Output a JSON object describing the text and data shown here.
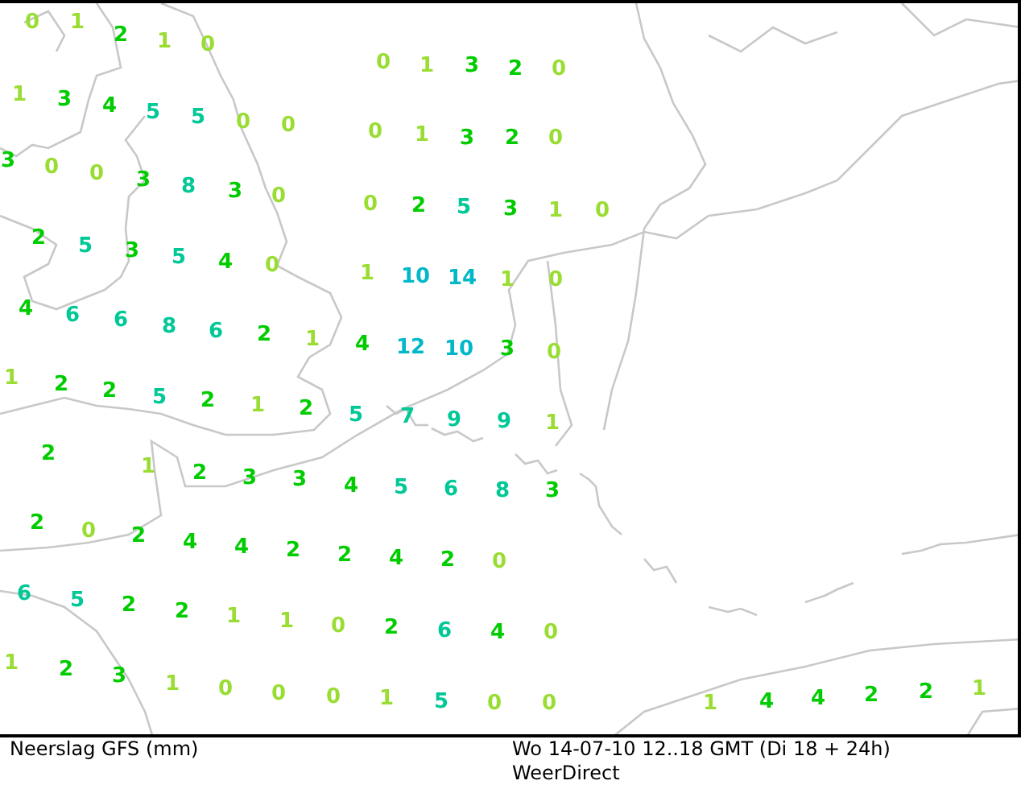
{
  "map": {
    "readings": [
      {
        "value": "0",
        "color": "#99dd33"
      },
      {
        "value": "1",
        "color": "#99dd33"
      },
      {
        "value": "2",
        "color": "#00cc00"
      },
      {
        "value": "1",
        "color": "#99dd33"
      },
      {
        "value": "0",
        "color": "#99dd33"
      },
      {
        "value": "1",
        "color": "#99dd33"
      },
      {
        "value": "3",
        "color": "#00cc00"
      },
      {
        "value": "4",
        "color": "#00cc00"
      },
      {
        "value": "5",
        "color": "#00c896"
      },
      {
        "value": "5",
        "color": "#00c896"
      },
      {
        "value": "0",
        "color": "#99dd33"
      },
      {
        "value": "0",
        "color": "#99dd33"
      },
      {
        "value": "3",
        "color": "#00cc00"
      },
      {
        "value": "0",
        "color": "#99dd33"
      },
      {
        "value": "0",
        "color": "#99dd33"
      },
      {
        "value": "3",
        "color": "#00cc00"
      },
      {
        "value": "8",
        "color": "#00c896"
      },
      {
        "value": "3",
        "color": "#00cc00"
      },
      {
        "value": "0",
        "color": "#99dd33"
      },
      {
        "value": "2",
        "color": "#00cc00"
      },
      {
        "value": "5",
        "color": "#00c896"
      },
      {
        "value": "3",
        "color": "#00cc00"
      },
      {
        "value": "5",
        "color": "#00c896"
      },
      {
        "value": "4",
        "color": "#00cc00"
      },
      {
        "value": "0",
        "color": "#99dd33"
      },
      {
        "value": "4",
        "color": "#00cc00"
      },
      {
        "value": "6",
        "color": "#00c896"
      },
      {
        "value": "6",
        "color": "#00c896"
      },
      {
        "value": "8",
        "color": "#00c896"
      },
      {
        "value": "6",
        "color": "#00c896"
      },
      {
        "value": "2",
        "color": "#00cc00"
      },
      {
        "value": "1",
        "color": "#99dd33"
      },
      {
        "value": "1",
        "color": "#99dd33"
      },
      {
        "value": "2",
        "color": "#00cc00"
      },
      {
        "value": "2",
        "color": "#00cc00"
      },
      {
        "value": "5",
        "color": "#00c896"
      },
      {
        "value": "2",
        "color": "#00cc00"
      },
      {
        "value": "1",
        "color": "#99dd33"
      },
      {
        "value": "2",
        "color": "#00cc00"
      },
      {
        "value": "2",
        "color": "#00cc00"
      },
      {
        "value": "1",
        "color": "#99dd33"
      },
      {
        "value": "2",
        "color": "#00cc00"
      },
      {
        "value": "3",
        "color": "#00cc00"
      },
      {
        "value": "3",
        "color": "#00cc00"
      },
      {
        "value": "2",
        "color": "#00cc00"
      },
      {
        "value": "0",
        "color": "#99dd33"
      },
      {
        "value": "2",
        "color": "#00cc00"
      },
      {
        "value": "4",
        "color": "#00cc00"
      },
      {
        "value": "4",
        "color": "#00cc00"
      },
      {
        "value": "2",
        "color": "#00cc00"
      },
      {
        "value": "6",
        "color": "#00c896"
      },
      {
        "value": "5",
        "color": "#00c896"
      },
      {
        "value": "2",
        "color": "#00cc00"
      },
      {
        "value": "2",
        "color": "#00cc00"
      },
      {
        "value": "1",
        "color": "#99dd33"
      },
      {
        "value": "1",
        "color": "#99dd33"
      },
      {
        "value": "1",
        "color": "#99dd33"
      },
      {
        "value": "2",
        "color": "#00cc00"
      },
      {
        "value": "3",
        "color": "#00cc00"
      },
      {
        "value": "1",
        "color": "#99dd33"
      },
      {
        "value": "0",
        "color": "#99dd33"
      },
      {
        "value": "0",
        "color": "#99dd33"
      },
      {
        "value": "0",
        "color": "#99dd33"
      },
      {
        "value": "1",
        "color": "#99dd33"
      },
      {
        "value": "3",
        "color": "#00cc00"
      },
      {
        "value": "2",
        "color": "#00cc00"
      },
      {
        "value": "0",
        "color": "#99dd33"
      },
      {
        "value": "0",
        "color": "#99dd33"
      },
      {
        "value": "1",
        "color": "#99dd33"
      },
      {
        "value": "3",
        "color": "#00cc00"
      },
      {
        "value": "2",
        "color": "#00cc00"
      },
      {
        "value": "0",
        "color": "#99dd33"
      },
      {
        "value": "0",
        "color": "#99dd33"
      },
      {
        "value": "2",
        "color": "#00cc00"
      },
      {
        "value": "5",
        "color": "#00c896"
      },
      {
        "value": "3",
        "color": "#00cc00"
      },
      {
        "value": "1",
        "color": "#99dd33"
      },
      {
        "value": "0",
        "color": "#99dd33"
      },
      {
        "value": "1",
        "color": "#99dd33"
      },
      {
        "value": "10",
        "color": "#00b8c8"
      },
      {
        "value": "14",
        "color": "#00b8c8"
      },
      {
        "value": "1",
        "color": "#99dd33"
      },
      {
        "value": "0",
        "color": "#99dd33"
      },
      {
        "value": "4",
        "color": "#00cc00"
      },
      {
        "value": "12",
        "color": "#00b8c8"
      },
      {
        "value": "10",
        "color": "#00b8c8"
      },
      {
        "value": "3",
        "color": "#00cc00"
      },
      {
        "value": "0",
        "color": "#99dd33"
      },
      {
        "value": "5",
        "color": "#00c896"
      },
      {
        "value": "7",
        "color": "#00c896"
      },
      {
        "value": "9",
        "color": "#00c896"
      },
      {
        "value": "9",
        "color": "#00c896"
      },
      {
        "value": "1",
        "color": "#99dd33"
      },
      {
        "value": "4",
        "color": "#00cc00"
      },
      {
        "value": "5",
        "color": "#00c896"
      },
      {
        "value": "6",
        "color": "#00c896"
      },
      {
        "value": "8",
        "color": "#00c896"
      },
      {
        "value": "3",
        "color": "#00cc00"
      },
      {
        "value": "2",
        "color": "#00cc00"
      },
      {
        "value": "4",
        "color": "#00cc00"
      },
      {
        "value": "2",
        "color": "#00cc00"
      },
      {
        "value": "0",
        "color": "#99dd33"
      },
      {
        "value": "0",
        "color": "#99dd33"
      },
      {
        "value": "2",
        "color": "#00cc00"
      },
      {
        "value": "6",
        "color": "#00c896"
      },
      {
        "value": "4",
        "color": "#00cc00"
      },
      {
        "value": "0",
        "color": "#99dd33"
      },
      {
        "value": "0",
        "color": "#99dd33"
      },
      {
        "value": "1",
        "color": "#99dd33"
      },
      {
        "value": "5",
        "color": "#00c896"
      },
      {
        "value": "0",
        "color": "#99dd33"
      },
      {
        "value": "0",
        "color": "#99dd33"
      },
      {
        "value": "1",
        "color": "#99dd33"
      },
      {
        "value": "4",
        "color": "#00cc00"
      },
      {
        "value": "4",
        "color": "#00cc00"
      },
      {
        "value": "2",
        "color": "#00cc00"
      },
      {
        "value": "2",
        "color": "#00cc00"
      },
      {
        "value": "1",
        "color": "#99dd33"
      }
    ]
  },
  "footer": {
    "title": "Neerslag GFS (mm)",
    "timestamp": "Wo 14-07-10 12..18 GMT (Di 18 + 24h)",
    "source": "WeerDirect"
  }
}
